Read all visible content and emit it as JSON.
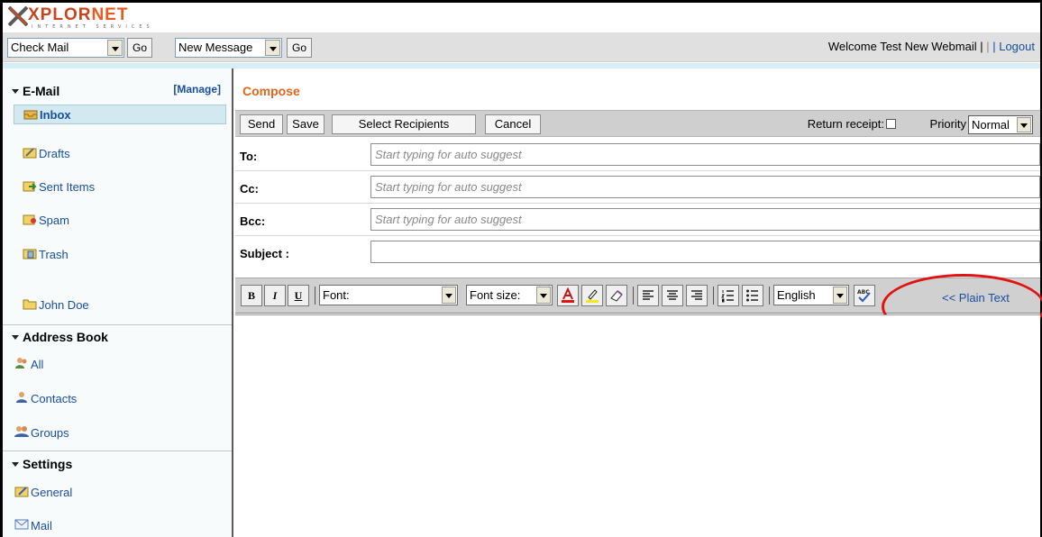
{
  "brand": {
    "name_part1": "XPLOR",
    "name_part2": "NET",
    "tagline": "INTERNET SERVICES",
    "colors": {
      "primary": "#c9441e",
      "accent": "#e95a20",
      "link": "#1a4fa0",
      "annotation": "#e01313"
    }
  },
  "toolbar": {
    "check_mail": "Check Mail",
    "go1": "Go",
    "new_message": "New Message",
    "go2": "Go",
    "welcome": "Welcome Test New Webmail |",
    "separator": "|",
    "logout": "| Logout"
  },
  "sidebar": {
    "email_title": "E-Mail",
    "manage": "[Manage]",
    "mail_items": [
      {
        "label": "Inbox",
        "icon": "inbox-icon"
      },
      {
        "label": "Drafts",
        "icon": "drafts-icon"
      },
      {
        "label": "Sent Items",
        "icon": "sent-icon"
      },
      {
        "label": "Spam",
        "icon": "spam-icon"
      },
      {
        "label": "Trash",
        "icon": "trash-icon"
      },
      {
        "label": "John Doe",
        "icon": "folder-icon"
      }
    ],
    "address_title": "Address Book",
    "address_items": [
      {
        "label": "All",
        "icon": "people-icon"
      },
      {
        "label": "Contacts",
        "icon": "contact-icon"
      },
      {
        "label": "Groups",
        "icon": "group-icon"
      }
    ],
    "settings_title": "Settings",
    "settings_items": [
      {
        "label": "General",
        "icon": "general-icon"
      },
      {
        "label": "Mail",
        "icon": "mail-icon"
      }
    ]
  },
  "compose": {
    "title": "Compose",
    "buttons": {
      "send": "Send",
      "save": "Save",
      "select_recipients": "Select Recipients",
      "cancel": "Cancel"
    },
    "return_receipt": "Return receipt:",
    "priority_label": "Priority",
    "priority_value": "Normal",
    "fields": {
      "to_label": "To:",
      "cc_label": "Cc:",
      "bcc_label": "Bcc:",
      "subject_label": "Subject :",
      "placeholder": "Start typing for auto suggest"
    },
    "editor": {
      "bold": "B",
      "italic": "I",
      "underline": "U",
      "font": "Font:",
      "font_size": "Font size:",
      "language": "English",
      "plain_text": "<< Plain Text"
    }
  }
}
